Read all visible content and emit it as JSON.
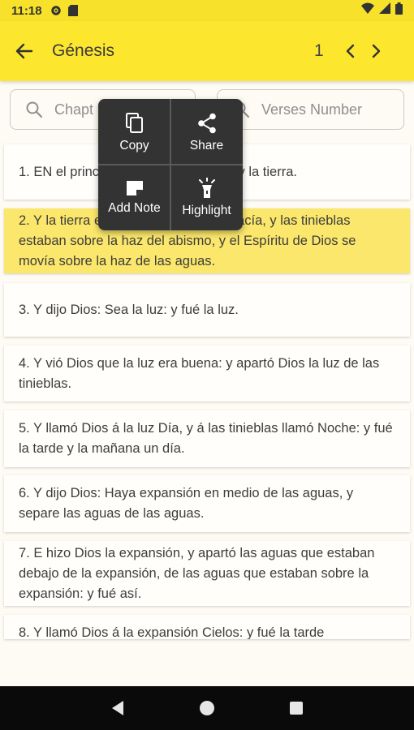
{
  "status": {
    "time": "11:18"
  },
  "header": {
    "title": "Génesis",
    "chapter": "1"
  },
  "search": {
    "chapter_placeholder": "Chapt",
    "verses_placeholder": "Verses Number"
  },
  "popup": {
    "copy": "Copy",
    "share": "Share",
    "add_note": "Add Note",
    "highlight": "Highlight"
  },
  "verses": [
    "1. EN el principio crió Dios los cielos y la tierra.",
    "2. Y la tierra estaba desordenada y vacía, y las tinieblas estaban sobre la haz del abismo, y el Espíritu de Dios se movía sobre la haz de las aguas.",
    "3. Y dijo Dios: Sea la luz: y fué la luz.",
    "4. Y vió Dios que la luz era buena: y apartó Dios la luz de las tinieblas.",
    "5. Y llamó Dios á la luz Día, y á las tinieblas llamó Noche: y fué la tarde y la mañana un día.",
    "6. Y dijo Dios: Haya expansión en medio de las aguas, y separe las aguas de las aguas.",
    "7. E hizo Dios la expansión, y apartó las aguas que estaban debajo de la expansión, de las aguas que estaban sobre la expansión: y fué así.",
    "8. Y llamó Dios á la expansión Cielos: y fué la tarde"
  ],
  "colors": {
    "accent": "#fce62e",
    "highlight": "#fbe76b",
    "popup": "#333333"
  }
}
